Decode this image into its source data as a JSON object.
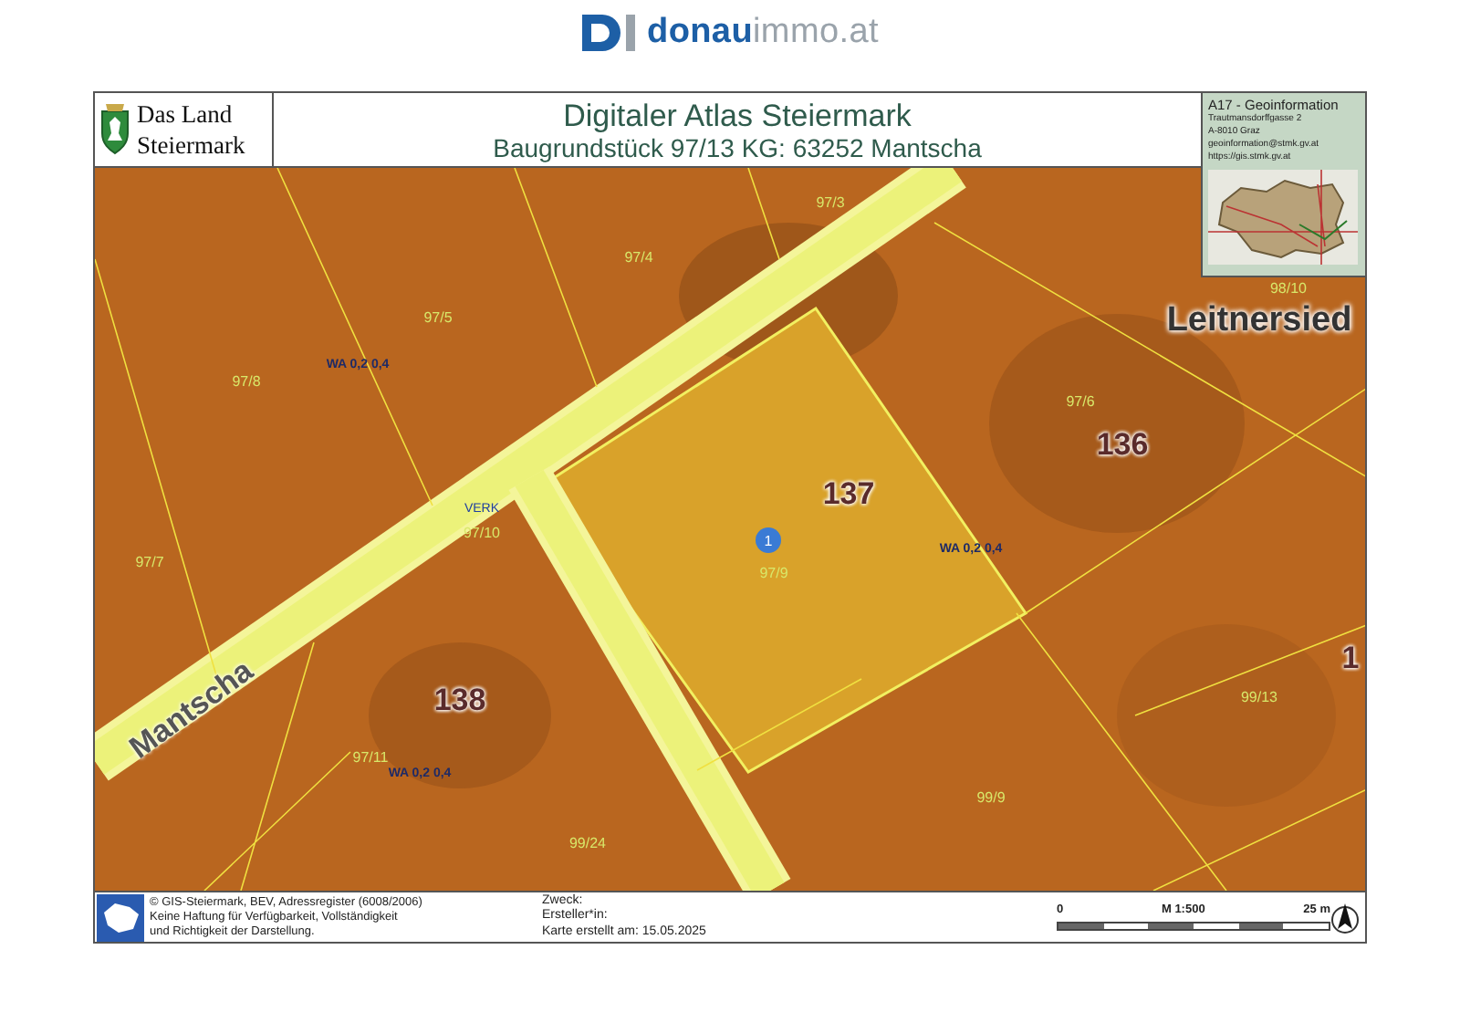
{
  "brand": {
    "name_bold": "donau",
    "name_light": "immo.at"
  },
  "header": {
    "logo_line_1": "Das Land",
    "logo_line_2": "Steiermark",
    "title": "Digitaler Atlas Steiermark",
    "subtitle": "Baugrundstück 97/13 KG: 63252 Mantscha"
  },
  "info_box": {
    "lines": [
      "A17 - Geoinformation",
      "Trautmansdorffgasse 2",
      "A-8010 Graz",
      "geoinformation@stmk.gv.at",
      "https://gis.stmk.gv.at"
    ]
  },
  "map_labels": [
    {
      "kind": "parcel",
      "text": "97/3"
    },
    {
      "kind": "parcel",
      "text": "97/4"
    },
    {
      "kind": "parcel",
      "text": "97/5"
    },
    {
      "kind": "parcel",
      "text": "97/8"
    },
    {
      "kind": "zoning",
      "text": "WA 0,2 0,4"
    },
    {
      "kind": "parcel",
      "text": "98/10"
    },
    {
      "kind": "place",
      "text": "Leitnersied"
    },
    {
      "kind": "parcel",
      "text": "97/6"
    },
    {
      "kind": "house",
      "text": "136"
    },
    {
      "kind": "house",
      "text": "137"
    },
    {
      "kind": "traffic",
      "text": "VERK"
    },
    {
      "kind": "parcel",
      "text": "97/10"
    },
    {
      "kind": "parcel",
      "text": "97/7"
    },
    {
      "kind": "pin",
      "text": "1"
    },
    {
      "kind": "parcel",
      "text": "97/9"
    },
    {
      "kind": "zoning",
      "text": "WA 0,2 0,4"
    },
    {
      "kind": "house",
      "text": "1"
    },
    {
      "kind": "parcel",
      "text": "99/13"
    },
    {
      "kind": "street",
      "text": "Mantscha"
    },
    {
      "kind": "house",
      "text": "138"
    },
    {
      "kind": "parcel",
      "text": "97/11"
    },
    {
      "kind": "zoning",
      "text": "WA 0,2 0,4"
    },
    {
      "kind": "parcel",
      "text": "99/9"
    },
    {
      "kind": "parcel",
      "text": "99/24"
    }
  ],
  "footer": {
    "credits": [
      "© GIS-Steiermark, BEV, Adressregister (6008/2006)",
      "Keine Haftung für Verfügbarkeit, Vollständigkeit",
      "und Richtigkeit der Darstellung."
    ],
    "meta": [
      "Zweck:",
      "Ersteller*in:",
      "Karte erstellt am: 15.05.2025"
    ],
    "scale": {
      "start": "0",
      "ratio": "M 1:500",
      "end": "25 m"
    }
  }
}
